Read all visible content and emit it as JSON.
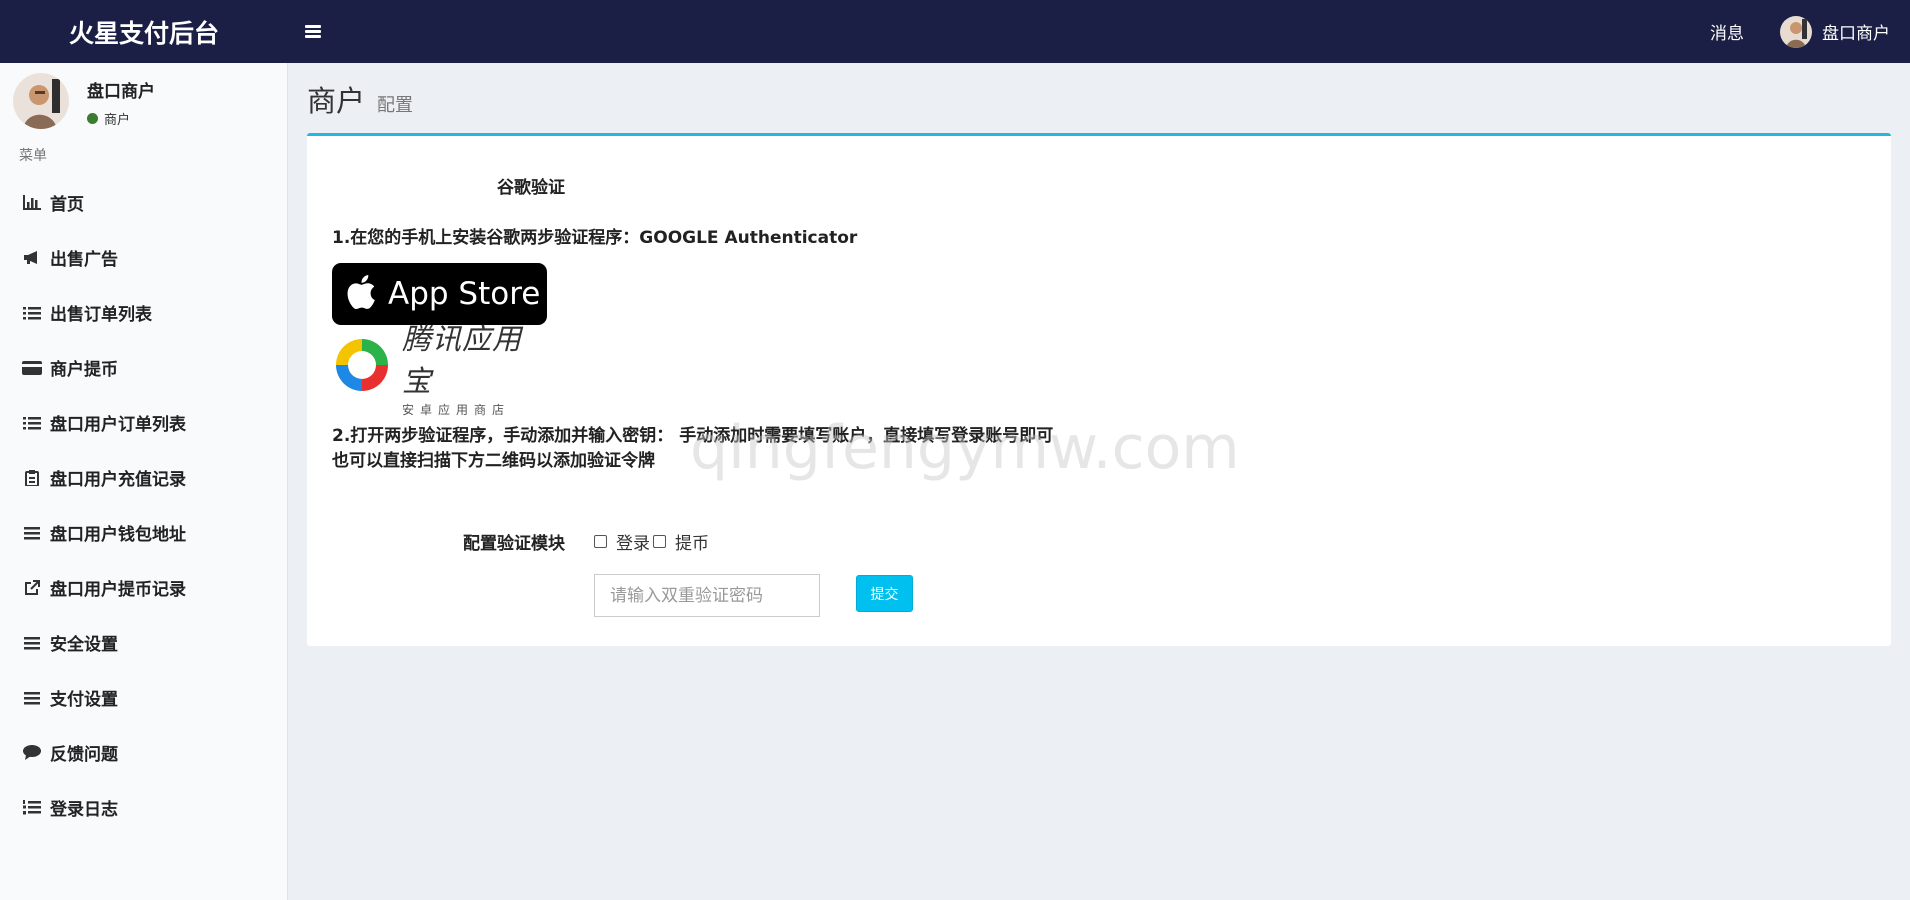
{
  "header": {
    "brand": "火星支付后台",
    "messages_label": "消息",
    "user_name": "盘口商户"
  },
  "sidebar": {
    "user_name": "盘口商户",
    "user_role": "商户",
    "menu_header": "菜单",
    "items": [
      {
        "label": "首页",
        "icon": "bar-chart-icon"
      },
      {
        "label": "出售广告",
        "icon": "bullhorn-icon"
      },
      {
        "label": "出售订单列表",
        "icon": "list-icon"
      },
      {
        "label": "商户提币",
        "icon": "credit-card-icon"
      },
      {
        "label": "盘口用户订单列表",
        "icon": "list-icon"
      },
      {
        "label": "盘口用户充值记录",
        "icon": "clipboard-icon"
      },
      {
        "label": "盘口用户钱包地址",
        "icon": "bars-icon"
      },
      {
        "label": "盘口用户提币记录",
        "icon": "external-link-icon"
      },
      {
        "label": "安全设置",
        "icon": "bars-icon"
      },
      {
        "label": "支付设置",
        "icon": "bars-icon"
      },
      {
        "label": "反馈问题",
        "icon": "comment-icon"
      },
      {
        "label": "登录日志",
        "icon": "list-ol-icon"
      }
    ]
  },
  "page": {
    "title": "商户",
    "subtitle": "配置"
  },
  "google_auth": {
    "section_label": "谷歌验证",
    "step1": "1.在您的手机上安装谷歌两步验证程序：GOOGLE Authenticator",
    "appstore_label": "App Store",
    "tencent_label": "腾讯应用宝",
    "tencent_sub": "安卓应用商店",
    "step2_line1": "2.打开两步验证程序，手动添加并输入密钥： 手动添加时需要填写账户，直接填写登录账号即可",
    "step2_line2": "也可以直接扫描下方二维码以添加验证令牌",
    "watermark": "qingfengymw.com",
    "config_label": "配置验证模块",
    "option_login": "登录",
    "option_withdraw": "提币",
    "input_placeholder": "请输入双重验证密码",
    "input_value": "",
    "submit_label": "提交"
  },
  "colors": {
    "header_bg": "#1b1e45",
    "accent": "#22b7df",
    "button": "#00c0ef",
    "status_online": "#3a7d2e"
  }
}
